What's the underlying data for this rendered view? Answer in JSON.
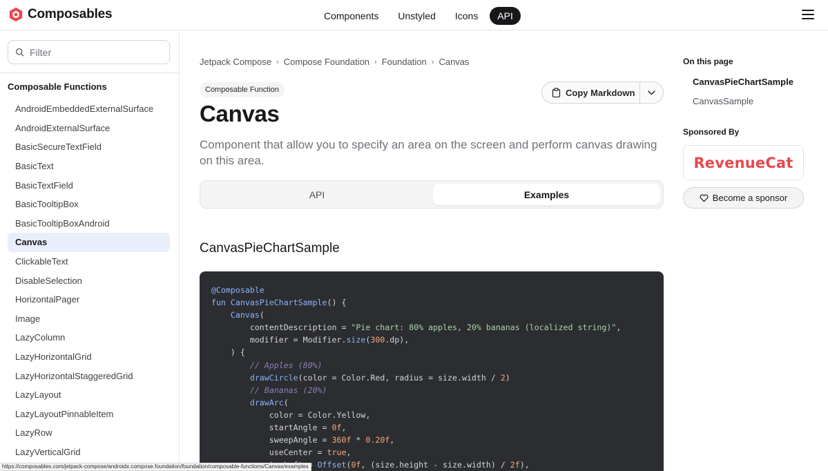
{
  "header": {
    "logo_text": "Composables",
    "nav": [
      {
        "label": "Components",
        "active": false
      },
      {
        "label": "Unstyled",
        "active": false
      },
      {
        "label": "Icons",
        "active": false
      },
      {
        "label": "API",
        "active": true
      }
    ],
    "menu_icon": "hamburger-icon"
  },
  "sidebar": {
    "filter_placeholder": "Filter",
    "heading": "Composable Functions",
    "items": [
      {
        "label": "AndroidEmbeddedExternalSurface"
      },
      {
        "label": "AndroidExternalSurface"
      },
      {
        "label": "BasicSecureTextField"
      },
      {
        "label": "BasicText"
      },
      {
        "label": "BasicTextField"
      },
      {
        "label": "BasicTooltipBox"
      },
      {
        "label": "BasicTooltipBoxAndroid"
      },
      {
        "label": "Canvas",
        "active": true
      },
      {
        "label": "ClickableText"
      },
      {
        "label": "DisableSelection"
      },
      {
        "label": "HorizontalPager"
      },
      {
        "label": "Image"
      },
      {
        "label": "LazyColumn"
      },
      {
        "label": "LazyHorizontalGrid"
      },
      {
        "label": "LazyHorizontalStaggeredGrid"
      },
      {
        "label": "LazyLayout"
      },
      {
        "label": "LazyLayoutPinnableItem"
      },
      {
        "label": "LazyRow"
      },
      {
        "label": "LazyVerticalGrid"
      }
    ]
  },
  "status_url": "https://composables.com/jetpack-compose/androidx.compose.foundation/foundation/composable-functions/Canvas/examples",
  "main": {
    "breadcrumb": [
      "Jetpack Compose",
      "Compose Foundation",
      "Foundation",
      "Canvas"
    ],
    "badge": "Composable Function",
    "copy_label": "Copy Markdown",
    "title": "Canvas",
    "description": "Component that allow you to specify an area on the screen and perform canvas drawing on this area.",
    "tabs": [
      {
        "label": "API",
        "active": false
      },
      {
        "label": "Examples",
        "active": true
      }
    ],
    "section_title": "CanvasPieChartSample",
    "code_lines": [
      [
        [
          "k",
          "@Composable"
        ]
      ],
      [
        [
          "k",
          "fun "
        ],
        [
          "k",
          "CanvasPieChartSample"
        ],
        [
          "p",
          "() {"
        ]
      ],
      [
        [
          "p",
          "    "
        ],
        [
          "k",
          "Canvas"
        ],
        [
          "p",
          "("
        ]
      ],
      [
        [
          "p",
          "        contentDescription = "
        ],
        [
          "s",
          "\"Pie chart: 80% apples, 20% bananas (localized string)\""
        ],
        [
          "p",
          ","
        ]
      ],
      [
        [
          "p",
          "        modifier = Modifier."
        ],
        [
          "k",
          "size"
        ],
        [
          "p",
          "("
        ],
        [
          "n",
          "300"
        ],
        [
          "p",
          ".dp),"
        ]
      ],
      [
        [
          "p",
          "    ) {"
        ]
      ],
      [
        [
          "c",
          "        // Apples (80%)"
        ]
      ],
      [
        [
          "p",
          "        "
        ],
        [
          "k",
          "drawCircle"
        ],
        [
          "p",
          "(color = Color.Red, radius = size.width / "
        ],
        [
          "n",
          "2"
        ],
        [
          "p",
          ")"
        ]
      ],
      [
        [
          "c",
          "        // Bananas (20%)"
        ]
      ],
      [
        [
          "p",
          "        "
        ],
        [
          "k",
          "drawArc"
        ],
        [
          "p",
          "("
        ]
      ],
      [
        [
          "p",
          "            color = Color.Yellow,"
        ]
      ],
      [
        [
          "p",
          "            startAngle = "
        ],
        [
          "n",
          "0f"
        ],
        [
          "p",
          ","
        ]
      ],
      [
        [
          "p",
          "            sweepAngle = "
        ],
        [
          "n",
          "360f"
        ],
        [
          "p",
          " * "
        ],
        [
          "n",
          "0.20f"
        ],
        [
          "p",
          ","
        ]
      ],
      [
        [
          "p",
          "            useCenter = "
        ],
        [
          "n",
          "true"
        ],
        [
          "p",
          ","
        ]
      ],
      [
        [
          "p",
          "            topLeft = "
        ],
        [
          "k",
          "Offset"
        ],
        [
          "p",
          "("
        ],
        [
          "n",
          "0f"
        ],
        [
          "p",
          ", (size.height - size.width) / "
        ],
        [
          "n",
          "2f"
        ],
        [
          "p",
          "),"
        ]
      ]
    ]
  },
  "right": {
    "toc_title": "On this page",
    "toc": [
      {
        "label": "CanvasPieChartSample",
        "active": true
      },
      {
        "label": "CanvasSample",
        "active": false
      }
    ],
    "sponsor_title": "Sponsored By",
    "sponsor_logo": "RevenueCat",
    "become_sponsor": "Become a sponsor"
  },
  "colors": {
    "accent_dark": "#18181b",
    "active_sidebar_bg": "#e8eefa",
    "code_bg": "#2b2d31",
    "sponsor_red": "#e5484d"
  }
}
